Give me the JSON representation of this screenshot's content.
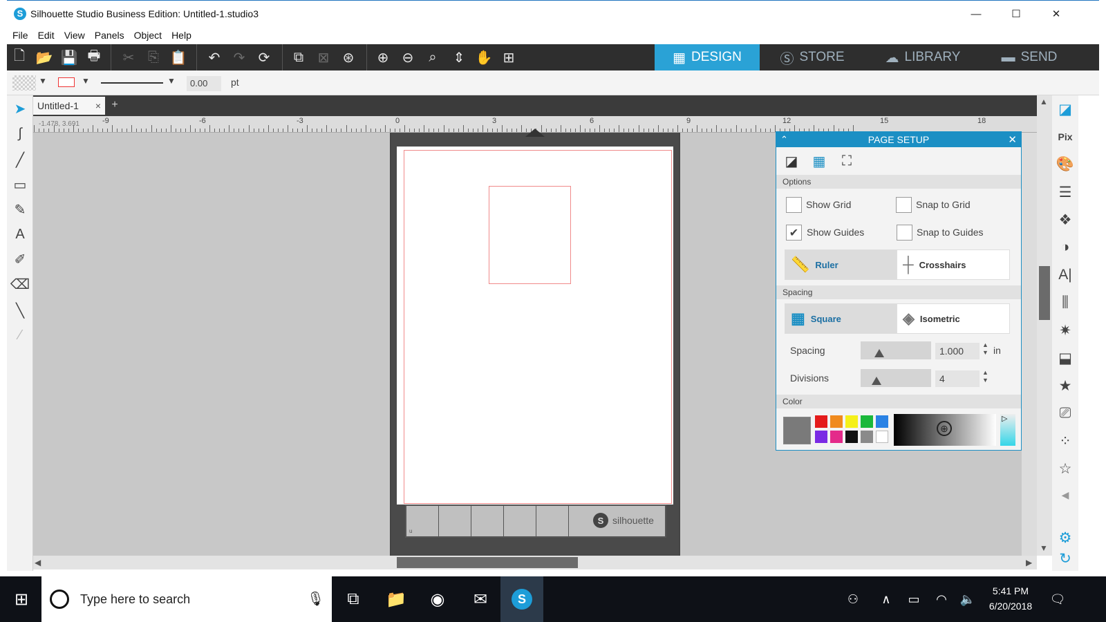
{
  "window": {
    "title": "Silhouette Studio Business Edition: Untitled-1.studio3",
    "minimize": "—",
    "maximize": "☐",
    "close": "✕"
  },
  "menu": [
    "File",
    "Edit",
    "View",
    "Panels",
    "Object",
    "Help"
  ],
  "nav_tabs": [
    {
      "label": "DESIGN",
      "icon": "grid-icon",
      "active": true
    },
    {
      "label": "STORE",
      "icon": "silhouette-s-icon",
      "active": false
    },
    {
      "label": "LIBRARY",
      "icon": "cloud-icon",
      "active": false
    },
    {
      "label": "SEND",
      "icon": "cutter-icon",
      "active": false
    }
  ],
  "properties": {
    "line_weight": "0.00",
    "line_unit": "pt"
  },
  "doc_tab": {
    "label": "Untitled-1",
    "close": "×",
    "add": "+"
  },
  "ruler": {
    "coord_readout": "-1.478, 3.691",
    "labels": [
      "-9",
      "-6",
      "-3",
      "0",
      "3",
      "6",
      "9",
      "12",
      "15",
      "18"
    ]
  },
  "mat": {
    "brand": "silhouette",
    "corner_mark": "u"
  },
  "page_setup": {
    "title": "PAGE SETUP",
    "options_heading": "Options",
    "show_grid": {
      "label": "Show Grid",
      "checked": false
    },
    "snap_to_grid": {
      "label": "Snap to Grid",
      "checked": false
    },
    "show_guides": {
      "label": "Show Guides",
      "checked": true
    },
    "snap_to_guides": {
      "label": "Snap to Guides",
      "checked": false
    },
    "ruler_label": "Ruler",
    "crosshairs_label": "Crosshairs",
    "spacing_heading": "Spacing",
    "square_label": "Square",
    "isometric_label": "Isometric",
    "spacing_label": "Spacing",
    "spacing_value": "1.000",
    "spacing_unit": "in",
    "divisions_label": "Divisions",
    "divisions_value": "4",
    "color_heading": "Color",
    "swatches": [
      "#e41b1b",
      "#f08a1d",
      "#f5f01a",
      "#1ab83a",
      "#2a82e4",
      "#7a2ae4",
      "#e42a8a",
      "#111111",
      "#8a8a8a",
      "#ffffff"
    ],
    "selected_color": "#7a7a7a"
  },
  "taskbar": {
    "search_placeholder": "Type here to search",
    "time": "5:41 PM",
    "date": "6/20/2018"
  }
}
